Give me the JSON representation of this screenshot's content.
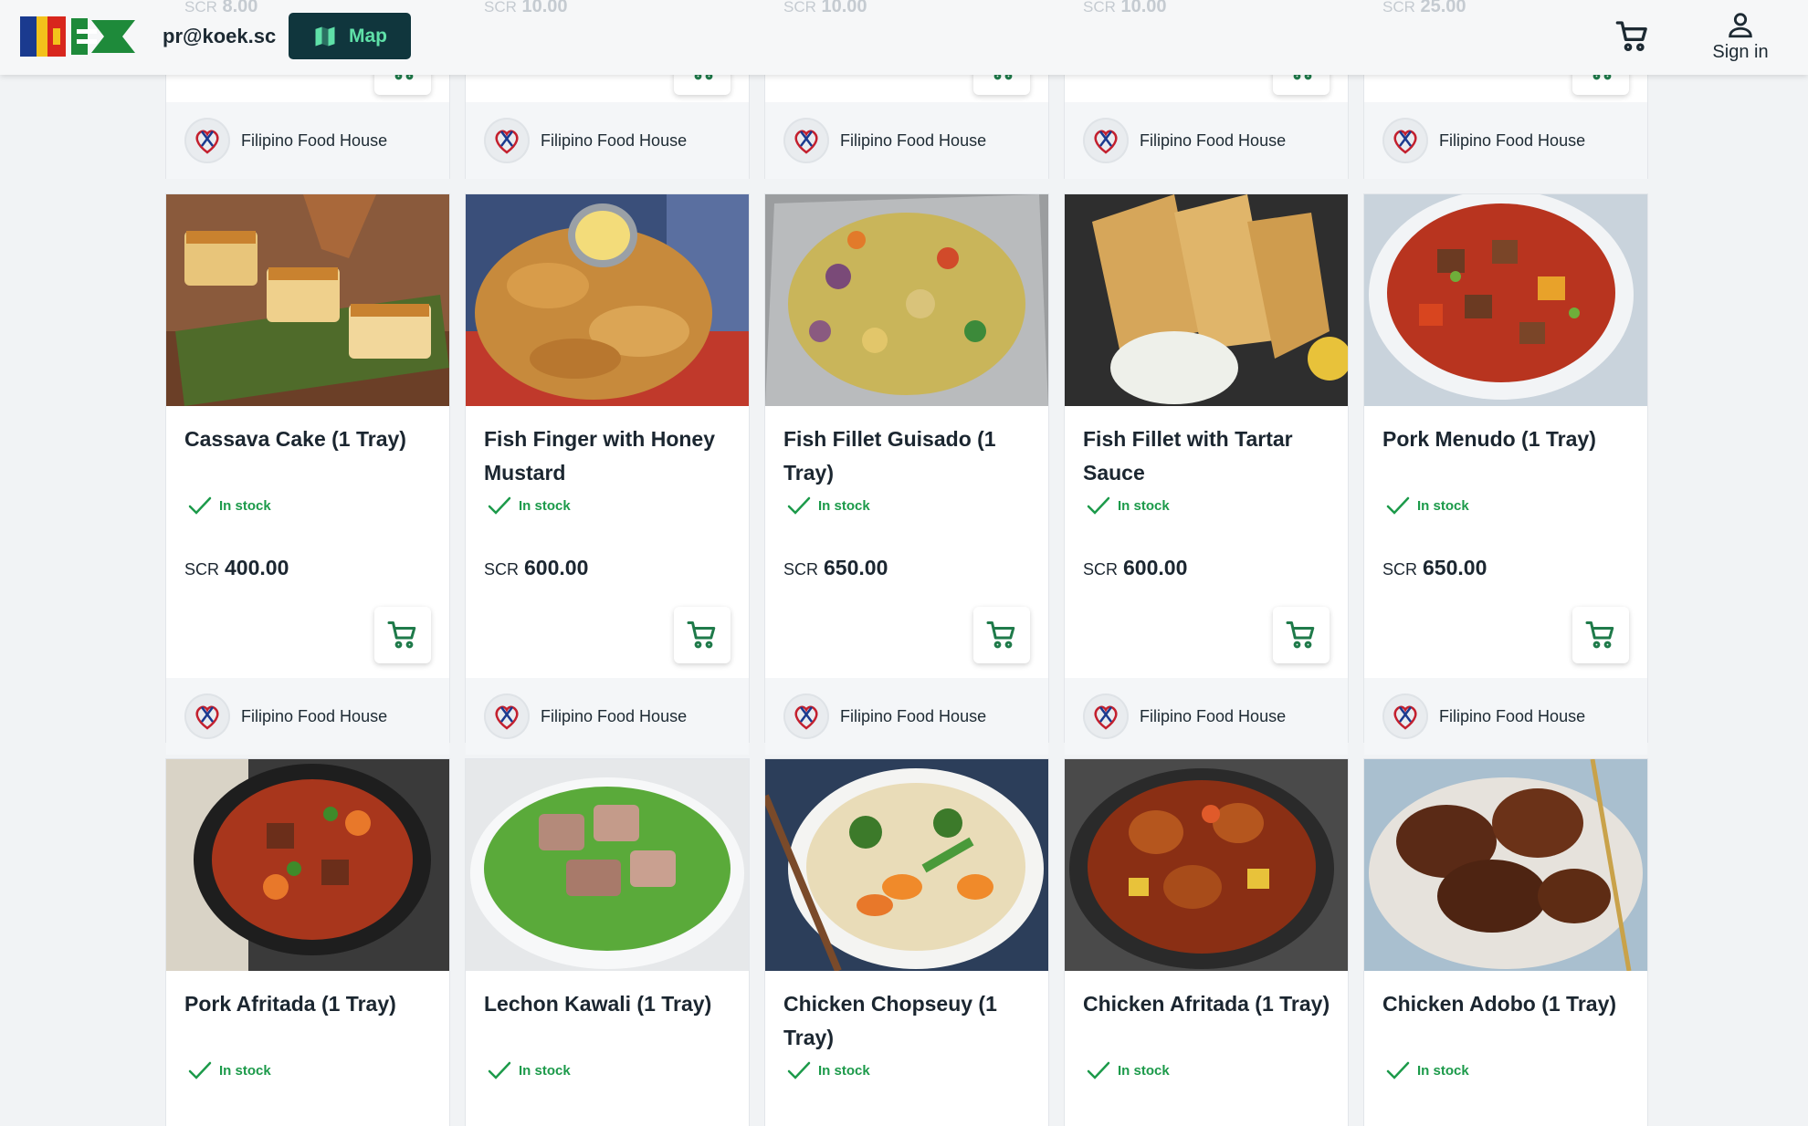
{
  "header": {
    "email": "pr@koek.sc",
    "map_label": "Map",
    "signin_label": "Sign in",
    "accent_color": "#10363d",
    "map_text_color": "#5fe0a8"
  },
  "top_row": {
    "prices": [
      {
        "currency": "SCR",
        "amount": "8.00"
      },
      {
        "currency": "SCR",
        "amount": "10.00"
      },
      {
        "currency": "SCR",
        "amount": "10.00"
      },
      {
        "currency": "SCR",
        "amount": "10.00"
      },
      {
        "currency": "SCR",
        "amount": "25.00"
      }
    ],
    "seller": "Filipino Food House"
  },
  "products": [
    {
      "title": "Cassava Cake (1 Tray)",
      "stock": "In stock",
      "currency": "SCR",
      "price": "400.00",
      "seller": "Filipino Food House",
      "image": "cassava-cake"
    },
    {
      "title": "Fish Finger with Honey Mustard",
      "stock": "In stock",
      "currency": "SCR",
      "price": "600.00",
      "seller": "Filipino Food House",
      "image": "fish-finger"
    },
    {
      "title": "Fish Fillet Guisado (1 Tray)",
      "stock": "In stock",
      "currency": "SCR",
      "price": "650.00",
      "seller": "Filipino Food House",
      "image": "fish-fillet-guisado"
    },
    {
      "title": "Fish Fillet with Tartar Sauce",
      "stock": "In stock",
      "currency": "SCR",
      "price": "600.00",
      "seller": "Filipino Food House",
      "image": "fish-fillet-tartar"
    },
    {
      "title": "Pork Menudo (1 Tray)",
      "stock": "In stock",
      "currency": "SCR",
      "price": "650.00",
      "seller": "Filipino Food House",
      "image": "pork-menudo"
    },
    {
      "title": "Pork Afritada (1 Tray)",
      "stock": "In stock",
      "image": "pork-afritada"
    },
    {
      "title": "Lechon Kawali (1 Tray)",
      "stock": "In stock",
      "image": "lechon-kawali"
    },
    {
      "title": "Chicken Chopseuy (1 Tray)",
      "stock": "In stock",
      "image": "chicken-chopseuy"
    },
    {
      "title": "Chicken Afritada (1 Tray)",
      "stock": "In stock",
      "image": "chicken-afritada"
    },
    {
      "title": "Chicken Adobo (1 Tray)",
      "stock": "In stock",
      "image": "chicken-adobo"
    }
  ],
  "colors": {
    "stock_green": "#1c9a4a",
    "cart_icon": "#1f7a4a"
  }
}
